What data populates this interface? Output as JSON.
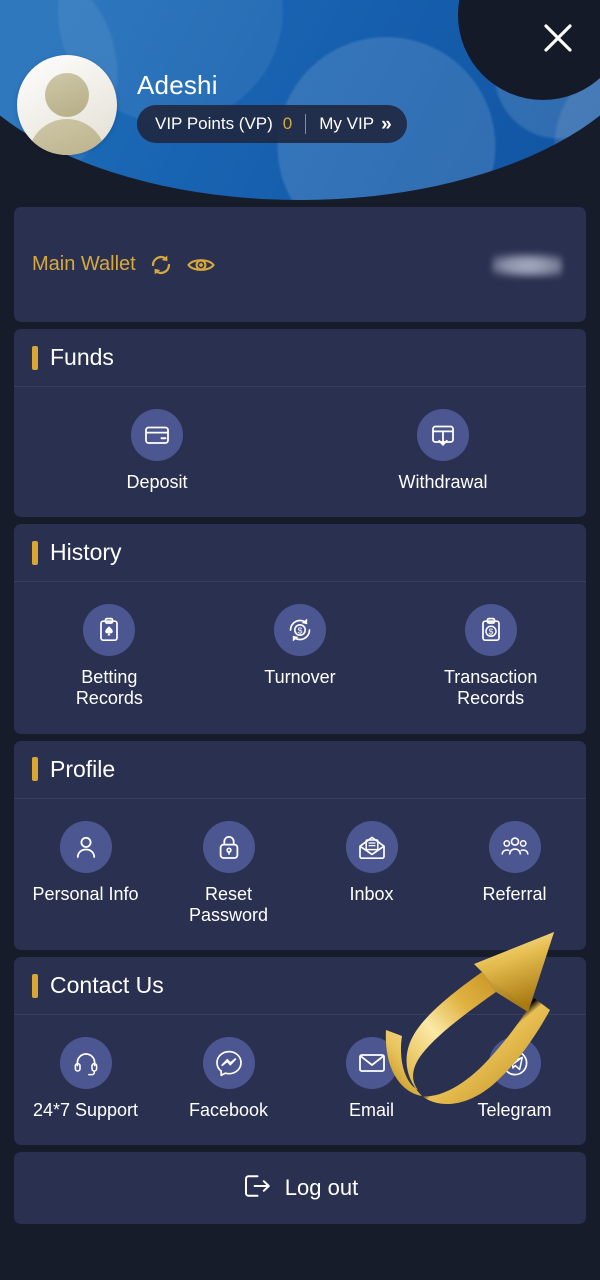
{
  "header": {
    "close_icon": "close-icon",
    "avatar_icon": "avatar",
    "user_name": "Adeshi",
    "vip": {
      "points_label": "VIP Points (VP)",
      "points_value": "0",
      "my_vip_label": "My VIP",
      "chevron": "»"
    }
  },
  "wallet": {
    "label": "Main Wallet",
    "refresh_icon": "refresh-icon",
    "eye_icon": "eye-icon",
    "balance": ""
  },
  "sections": [
    {
      "title": "Funds",
      "columns": 2,
      "items": [
        {
          "label": "Deposit",
          "icon": "credit-card-icon"
        },
        {
          "label": "Withdrawal",
          "icon": "card-download-icon"
        }
      ]
    },
    {
      "title": "History",
      "columns": 3,
      "items": [
        {
          "label": "Betting Records",
          "icon": "clipboard-spade-icon"
        },
        {
          "label": "Turnover",
          "icon": "refresh-dollar-icon"
        },
        {
          "label": "Transaction Records",
          "icon": "clipboard-dollar-icon"
        }
      ]
    },
    {
      "title": "Profile",
      "columns": 4,
      "items": [
        {
          "label": "Personal Info",
          "icon": "user-icon"
        },
        {
          "label": "Reset Password",
          "icon": "lock-icon"
        },
        {
          "label": "Inbox",
          "icon": "open-envelope-icon"
        },
        {
          "label": "Referral",
          "icon": "group-people-icon"
        }
      ]
    },
    {
      "title": "Contact Us",
      "columns": 4,
      "items": [
        {
          "label": "24*7 Support",
          "icon": "headset-icon"
        },
        {
          "label": "Facebook",
          "icon": "messenger-icon"
        },
        {
          "label": "Email",
          "icon": "envelope-icon"
        },
        {
          "label": "Telegram",
          "icon": "telegram-icon"
        }
      ]
    }
  ],
  "logout": {
    "label": "Log out",
    "icon": "logout-icon"
  },
  "annotation": {
    "arrow_icon": "gold-curved-arrow-pointing-to-referral"
  },
  "colors": {
    "page_bg": "#171c2b",
    "card_bg": "#2a3050",
    "header_blue": "#1d6cb8",
    "accent_gold": "#d9a533",
    "icon_circle": "#4c5792",
    "text_primary": "#ffffff"
  }
}
